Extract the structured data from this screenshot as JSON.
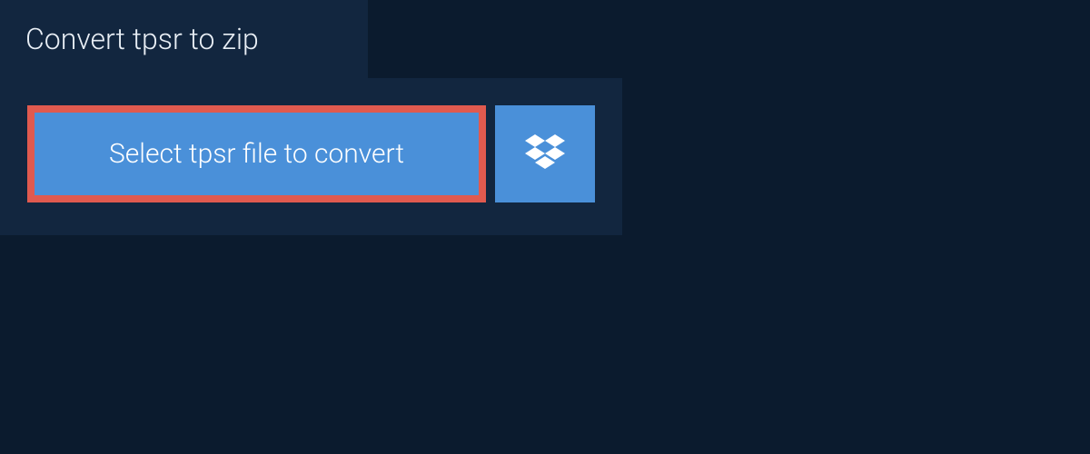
{
  "header": {
    "title": "Convert tpsr to zip"
  },
  "actions": {
    "select_file_label": "Select tpsr file to convert"
  },
  "colors": {
    "background": "#0b1b2e",
    "panel": "#12263f",
    "button": "#4a90d9",
    "highlight_border": "#e05a4f",
    "text_light": "#e8eef5",
    "text_on_button": "#ffffff"
  }
}
